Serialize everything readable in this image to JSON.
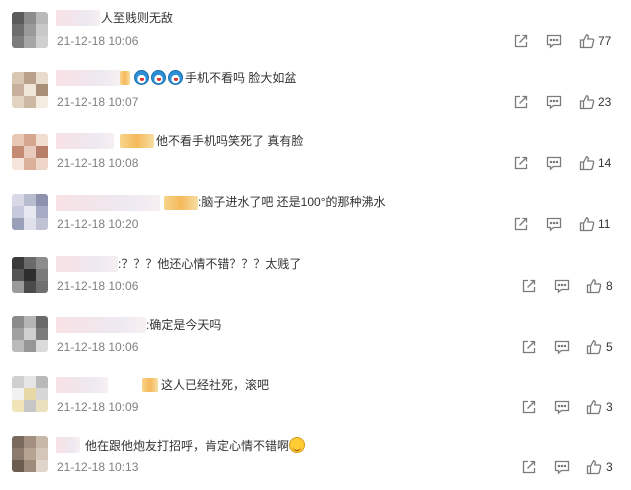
{
  "comments": [
    {
      "text": "人至贱则无敌",
      "time": "21-12-18 10:06",
      "likes": "77"
    },
    {
      "text": "手机不看吗 脸大如盆",
      "time": "21-12-18 10:07",
      "likes": "23"
    },
    {
      "text": "他不看手机吗笑死了 真有脸",
      "time": "21-12-18 10:08",
      "likes": "14"
    },
    {
      "text": ":脑子进水了吧 还是100°的那种沸水",
      "time": "21-12-18 10:20",
      "likes": "11"
    },
    {
      "text": ":？？？他还心情不错？？？太贱了",
      "time": "21-12-18 10:06",
      "likes": "8"
    },
    {
      "text": ":确定是今天吗",
      "time": "21-12-18 10:06",
      "likes": "5"
    },
    {
      "text": "这人已经社死，滚吧",
      "time": "21-12-18 10:09",
      "likes": "3"
    },
    {
      "text": "他在跟他炮友打招呼，肯定心情不错啊",
      "time": "21-12-18 10:13",
      "likes": "3"
    }
  ],
  "icons": {
    "repost": "repost-icon",
    "comment": "comment-icon",
    "like": "thumbs-up-icon",
    "emoji_doraemon": "doraemon-emoji-icon",
    "emoji_smile": "smile-emoji-icon"
  },
  "colors": {
    "text": "#333333",
    "time": "#808080",
    "icon": "#7a7a7a",
    "badge": "#f5b95b"
  }
}
